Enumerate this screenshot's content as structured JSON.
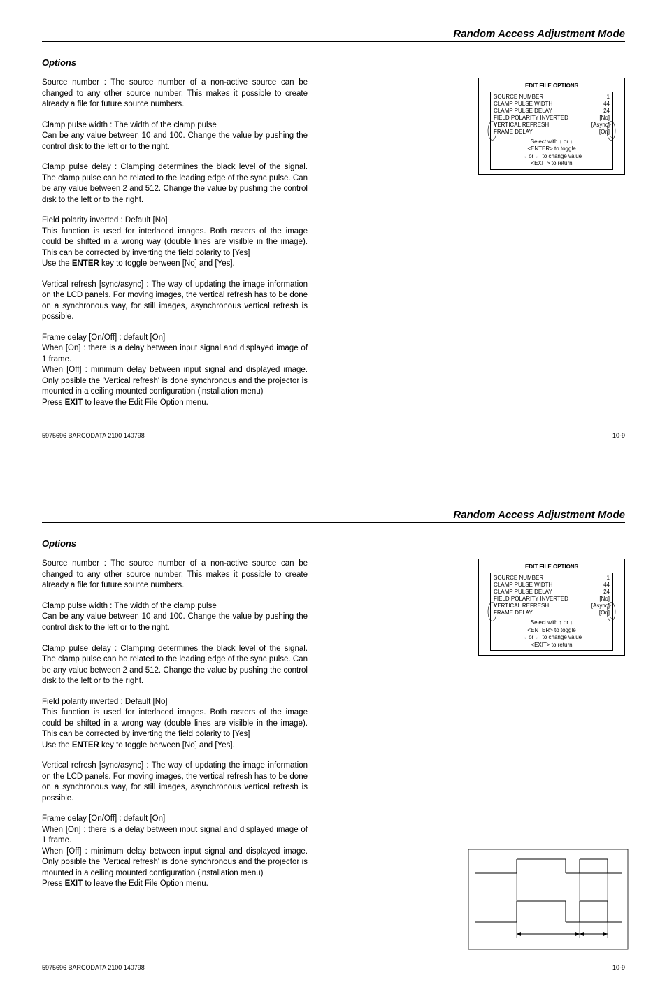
{
  "header": {
    "title": "Random Access Adjustment Mode"
  },
  "section": {
    "heading": "Options"
  },
  "paragraphs": {
    "p1": "Source number : The source number of a non-active source can be changed to any other source number.  This makes it possible to create already a file for future source numbers.",
    "p2": "Clamp pulse width : The width of the clamp pulse\nCan be any value between 10 and 100.  Change the value by pushing the control disk to the left or to the right.",
    "p3": "Clamp pulse delay : Clamping determines the black level of the signal. The clamp pulse can be related to the leading edge of the sync pulse. Can be any value between 2 and 512.  Change the value by pushing the control disk to the left or to the right.",
    "p4a": "Field polarity inverted : Default [No]",
    "p4b": "This function is used for interlaced images.  Both rasters of the image could be shifted in a wrong way (double lines are visilble in the image). This can be corrected by inverting the field polarity to [Yes]",
    "p4c_pre": "Use the ",
    "p4c_bold": "ENTER",
    "p4c_post": " key to toggle berween [No] and [Yes].",
    "p5": "Vertical refresh [sync/async] : The way of updating the image information on the LCD panels.  For moving images, the vertical refresh has to be done on a synchronous way, for still images, asynchronous vertical refresh is possible.",
    "p6a": "Frame delay [On/Off] : default [On]",
    "p6b": "When [On] : there is a delay between input signal and displayed image of 1 frame.",
    "p6c": "When [Off] : minimum delay between input signal and displayed image.  Only posible the 'Vertical refresh' is done synchronous and the projector is mounted in a ceiling mounted configuration (installation menu)",
    "p6d_pre": "Press ",
    "p6d_bold": "EXIT",
    "p6d_post": " to leave the Edit File Option menu."
  },
  "osd": {
    "title": "EDIT FILE OPTIONS",
    "rows": [
      {
        "label": "SOURCE NUMBER",
        "value": "1"
      },
      {
        "label": "CLAMP PULSE WIDTH",
        "value": "44"
      },
      {
        "label": "CLAMP PULSE DELAY",
        "value": "24"
      },
      {
        "label": "FIELD POLARITY INVERTED",
        "value": "[No]"
      },
      {
        "label": "VERTICAL REFRESH",
        "value": "[Async]"
      },
      {
        "label": "FRAME DELAY",
        "value": "[On]"
      }
    ],
    "help": {
      "l1": "Select with ↑ or ↓",
      "l2": "<ENTER> to toggle",
      "l3": "→ or ← to change value",
      "l4": "<EXIT> to return"
    }
  },
  "footer": {
    "left": "5975696 BARCODATA 2100 140798",
    "right": "10-9"
  }
}
